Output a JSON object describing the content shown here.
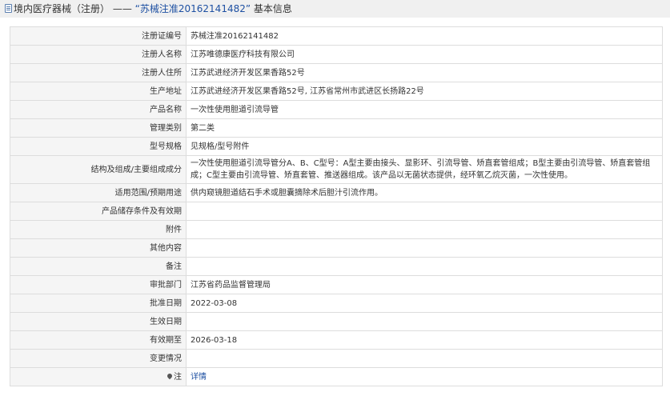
{
  "header": {
    "category": "境内医疗器械（注册）",
    "separator": " —— ",
    "record_title": "“苏械注准20162141482”",
    "suffix": " 基本信息"
  },
  "rows": [
    {
      "label": "注册证编号",
      "value": "苏械注准20162141482"
    },
    {
      "label": "注册人名称",
      "value": "江苏唯德康医疗科技有限公司"
    },
    {
      "label": "注册人住所",
      "value": "江苏武进经济开发区果香路52号"
    },
    {
      "label": "生产地址",
      "value": "江苏武进经济开发区果香路52号, 江苏省常州市武进区长扬路22号"
    },
    {
      "label": "产品名称",
      "value": "一次性使用胆道引流导管"
    },
    {
      "label": "管理类别",
      "value": "第二类"
    },
    {
      "label": "型号规格",
      "value": "见规格/型号附件"
    },
    {
      "label": "结构及组成/主要组成成分",
      "value": "一次性使用胆道引流导管分A、B、C型号：A型主要由接头、显影环、引流导管、矫直套管组成；B型主要由引流导管、矫直套管组成；C型主要由引流导管、矫直套管、推送器组成。该产品以无菌状态提供，经环氧乙烷灭菌，一次性使用。"
    },
    {
      "label": "适用范围/预期用途",
      "value": "供内窥镜胆道结石手术或胆囊摘除术后胆汁引流作用。"
    },
    {
      "label": "产品储存条件及有效期",
      "value": ""
    },
    {
      "label": "附件",
      "value": ""
    },
    {
      "label": "其他内容",
      "value": ""
    },
    {
      "label": "备注",
      "value": ""
    },
    {
      "label": "审批部门",
      "value": "江苏省药品监督管理局"
    },
    {
      "label": "批准日期",
      "value": "2022-03-08"
    },
    {
      "label": "生效日期",
      "value": ""
    },
    {
      "label": "有效期至",
      "value": "2026-03-18"
    },
    {
      "label": "变更情况",
      "value": ""
    }
  ],
  "note_row": {
    "label": "注",
    "icon": "pin-icon",
    "link_text": "详情"
  },
  "colors": {
    "header_bg": "#f0f0f0",
    "label_bg": "#f5f5f5",
    "border": "#dddddd",
    "link": "#1e50a2"
  }
}
